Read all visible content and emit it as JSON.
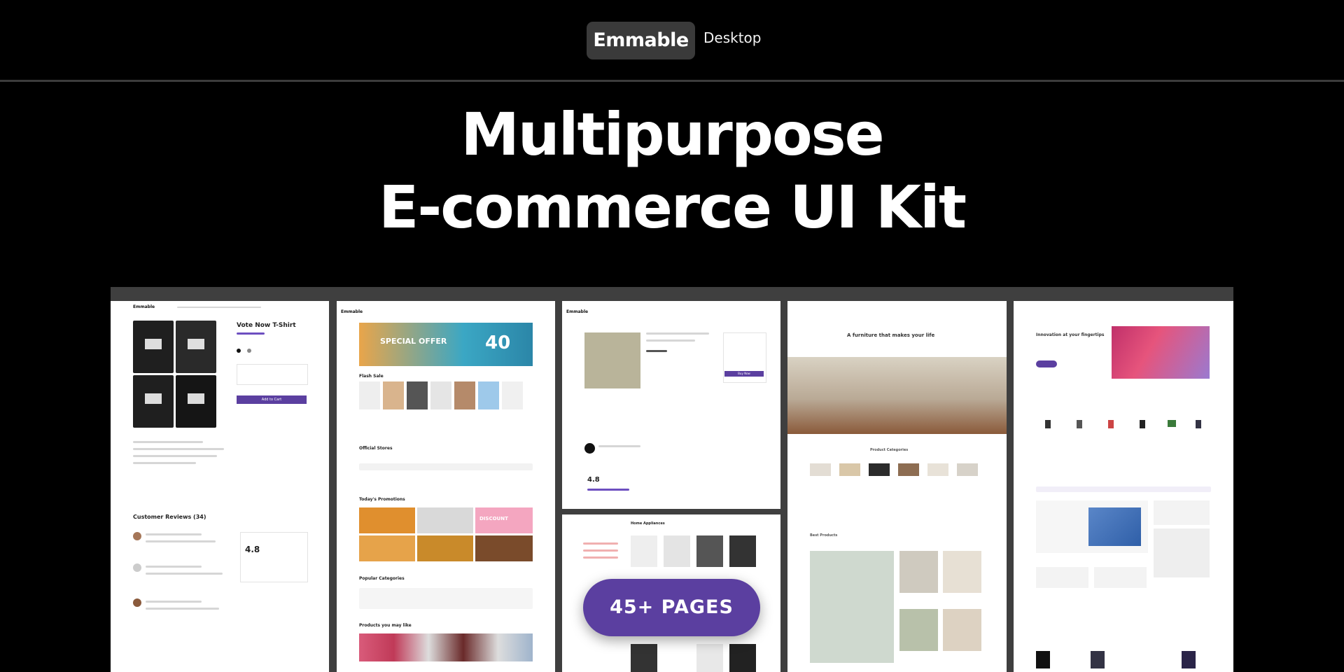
{
  "header": {
    "brand": "Emmable",
    "platform": "Desktop"
  },
  "hero": {
    "line1": "Multipurpose",
    "line2": "E-commerce UI Kit"
  },
  "badge": {
    "label": "45+ PAGES"
  },
  "screens": {
    "product": {
      "logo": "Emmable",
      "title": "Vote Now T-Shirt",
      "add_to_cart": "Add to Cart",
      "reviews_title": "Customer Reviews (34)",
      "rating": "4.8"
    },
    "marketplace": {
      "logo": "Emmable",
      "banner_title": "SPECIAL OFFER",
      "banner_percent": "40",
      "flash_sale": "Flash Sale",
      "official_stores": "Official Stores",
      "todays_promotions": "Today's Promotions",
      "discount": "DISCOUNT",
      "popular_categories": "Popular Categories",
      "products_you_like": "Products you may like"
    },
    "electronics": {
      "logo": "Emmable",
      "buy_button": "Buy Now",
      "rating": "4.8"
    },
    "appliances": {
      "title": "Home Appliances"
    },
    "furniture": {
      "headline": "A furniture that makes your life",
      "section1": "Product Categories",
      "section2": "Best Products"
    },
    "tech": {
      "headline": "Innovation at your fingertips"
    }
  },
  "colors": {
    "background": "#000000",
    "brand_pill": "#3a3a3a",
    "accent": "#5b3fa0"
  }
}
